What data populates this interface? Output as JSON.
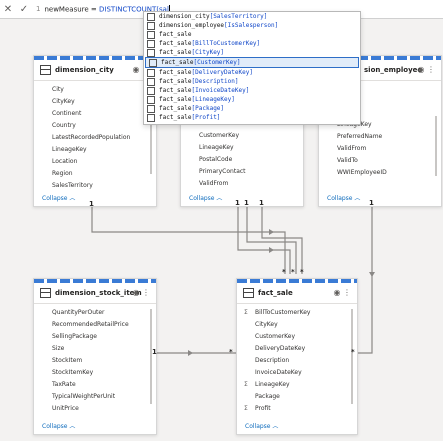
{
  "formula_bar": {
    "line_no": "1",
    "measure_name": "newMeasure = ",
    "expression": "DISTINCTCOUNT(sal"
  },
  "autocomplete": [
    {
      "table": "dimension_city",
      "column": "[SalesTerritory]"
    },
    {
      "table": "dimension_employee",
      "column": "[IsSalesperson]"
    },
    {
      "table": "fact_sale",
      "column": ""
    },
    {
      "table": "fact_sale",
      "column": "[BillToCustomerKey]"
    },
    {
      "table": "fact_sale",
      "column": "[CityKey]"
    },
    {
      "table": "fact_sale",
      "column": "[CustomerKey]"
    },
    {
      "table": "fact_sale",
      "column": "[DeliveryDateKey]"
    },
    {
      "table": "fact_sale",
      "column": "[Description]"
    },
    {
      "table": "fact_sale",
      "column": "[InvoiceDateKey]"
    },
    {
      "table": "fact_sale",
      "column": "[LineageKey]"
    },
    {
      "table": "fact_sale",
      "column": "[Package]"
    },
    {
      "table": "fact_sale",
      "column": "[Profit]"
    }
  ],
  "cards": {
    "city": {
      "title": "dimension_city",
      "collapse": "Collapse",
      "fields": [
        "City",
        "CityKey",
        "Continent",
        "Country",
        "LatestRecordedPopulation",
        "LineageKey",
        "Location",
        "Region",
        "SalesTerritory"
      ]
    },
    "customer": {
      "title": "",
      "collapse": "Collapse",
      "fields": [
        "CustomerID",
        "CustomerKey",
        "LineageKey",
        "PostalCode",
        "PrimaryContact",
        "ValidFrom"
      ]
    },
    "employee": {
      "title": "sion_employee",
      "collapse": "Collapse",
      "fields": [
        "ey",
        "son",
        "LineageKey",
        "PreferredName",
        "ValidFrom",
        "ValidTo",
        "WWIEmployeeID"
      ]
    },
    "stock": {
      "title": "dimension_stock_item",
      "collapse": "Collapse",
      "fields": [
        "QuantityPerOuter",
        "RecommendedRetailPrice",
        "SellingPackage",
        "Size",
        "StockItem",
        "StockItemKey",
        "TaxRate",
        "TypicalWeightPerUnit",
        "UnitPrice"
      ]
    },
    "fact": {
      "title": "fact_sale",
      "collapse": "Collapse",
      "fields": [
        {
          "name": "BillToCustomerKey",
          "sig": "Σ"
        },
        {
          "name": "CityKey",
          "sig": ""
        },
        {
          "name": "CustomerKey",
          "sig": ""
        },
        {
          "name": "DeliveryDateKey",
          "sig": ""
        },
        {
          "name": "Description",
          "sig": ""
        },
        {
          "name": "InvoiceDateKey",
          "sig": ""
        },
        {
          "name": "LineageKey",
          "sig": "Σ"
        },
        {
          "name": "Package",
          "sig": ""
        },
        {
          "name": "Profit",
          "sig": "Σ"
        }
      ]
    }
  },
  "relationships": {
    "one": "1",
    "many": "*"
  }
}
